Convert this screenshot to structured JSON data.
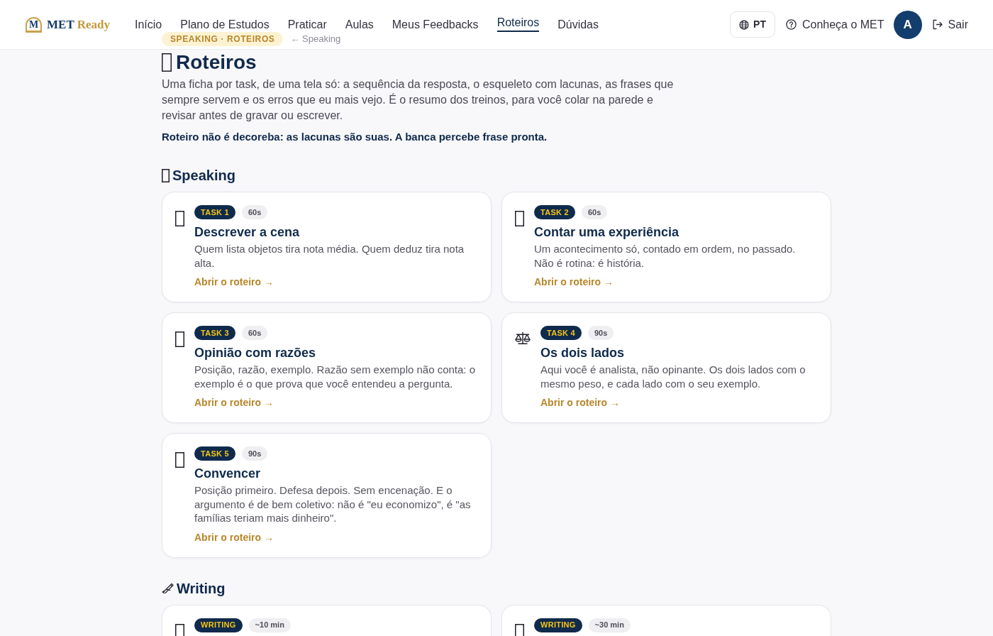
{
  "header": {
    "logo": {
      "mark": "M",
      "name": "MET",
      "name_accent": "Ready"
    },
    "nav": [
      {
        "label": "Início",
        "selected": false
      },
      {
        "label": "Plano de Estudos",
        "selected": false
      },
      {
        "label": "Praticar",
        "selected": false
      },
      {
        "label": "Aulas",
        "selected": false
      },
      {
        "label": "Meus Feedbacks",
        "selected": false
      },
      {
        "label": "Roteiros",
        "selected": true
      },
      {
        "label": "Dúvidas",
        "selected": false
      }
    ],
    "language": "PT",
    "help_link": "Conheça o MET",
    "avatar": "A",
    "logout": "Sair"
  },
  "breadcrumb": {
    "badge": "SPEAKING · ROTEIROS",
    "back_link": "← Speaking"
  },
  "page": {
    "title": "Roteiros",
    "description": "Uma ficha por task, de uma tela só: a sequência da resposta, o esqueleto com lacunas, as frases que sempre servem e os erros que eu mais vejo. É o resumo dos treinos, para você colar na parede e revisar antes de gravar ou escrever.",
    "note": "Roteiro não é decoreba: as lacunas são suas. A banca percebe frase pronta."
  },
  "sections": [
    {
      "kind": "glyph",
      "title": "Speaking",
      "cards": [
        {
          "kind": "glyph",
          "badge": "TASK 1",
          "duration": "60s",
          "title": "Descrever a cena",
          "description": "Quem lista objetos tira nota média. Quem deduz tira nota alta.",
          "link": "Abrir o roteiro →"
        },
        {
          "kind": "glyph",
          "badge": "TASK 2",
          "duration": "60s",
          "title": "Contar uma experiência",
          "description": "Um acontecimento só, contado em ordem, no passado. Não é rotina: é história.",
          "link": "Abrir o roteiro →"
        },
        {
          "kind": "glyph",
          "badge": "TASK 3",
          "duration": "60s",
          "title": "Opinião com razões",
          "description": "Posição, razão, exemplo. Razão sem exemplo não conta: o exemplo é o que prova que você entendeu a pergunta.",
          "link": "Abrir o roteiro →"
        },
        {
          "kind": "scales",
          "badge": "TASK 4",
          "duration": "90s",
          "title": "Os dois lados",
          "description": "Aqui você é analista, não opinante. Os dois lados com o mesmo peso, e cada lado com o seu exemplo.",
          "link": "Abrir o roteiro →"
        },
        {
          "kind": "glyph",
          "badge": "TASK 5",
          "duration": "90s",
          "title": "Convencer",
          "description": "Posição primeiro. Defesa depois. Sem encenação. E o argumento é de bem coletivo: não é \"eu economizo\", é \"as famílias teriam mais dinheiro\".",
          "link": "Abrir o roteiro →"
        }
      ]
    },
    {
      "kind": "pen",
      "title": "Writing",
      "cards": [
        {
          "kind": "glyph",
          "badge": "WRITING",
          "duration": "~10 min"
        },
        {
          "kind": "glyph",
          "badge": "WRITING",
          "duration": "~30 min"
        }
      ]
    }
  ]
}
